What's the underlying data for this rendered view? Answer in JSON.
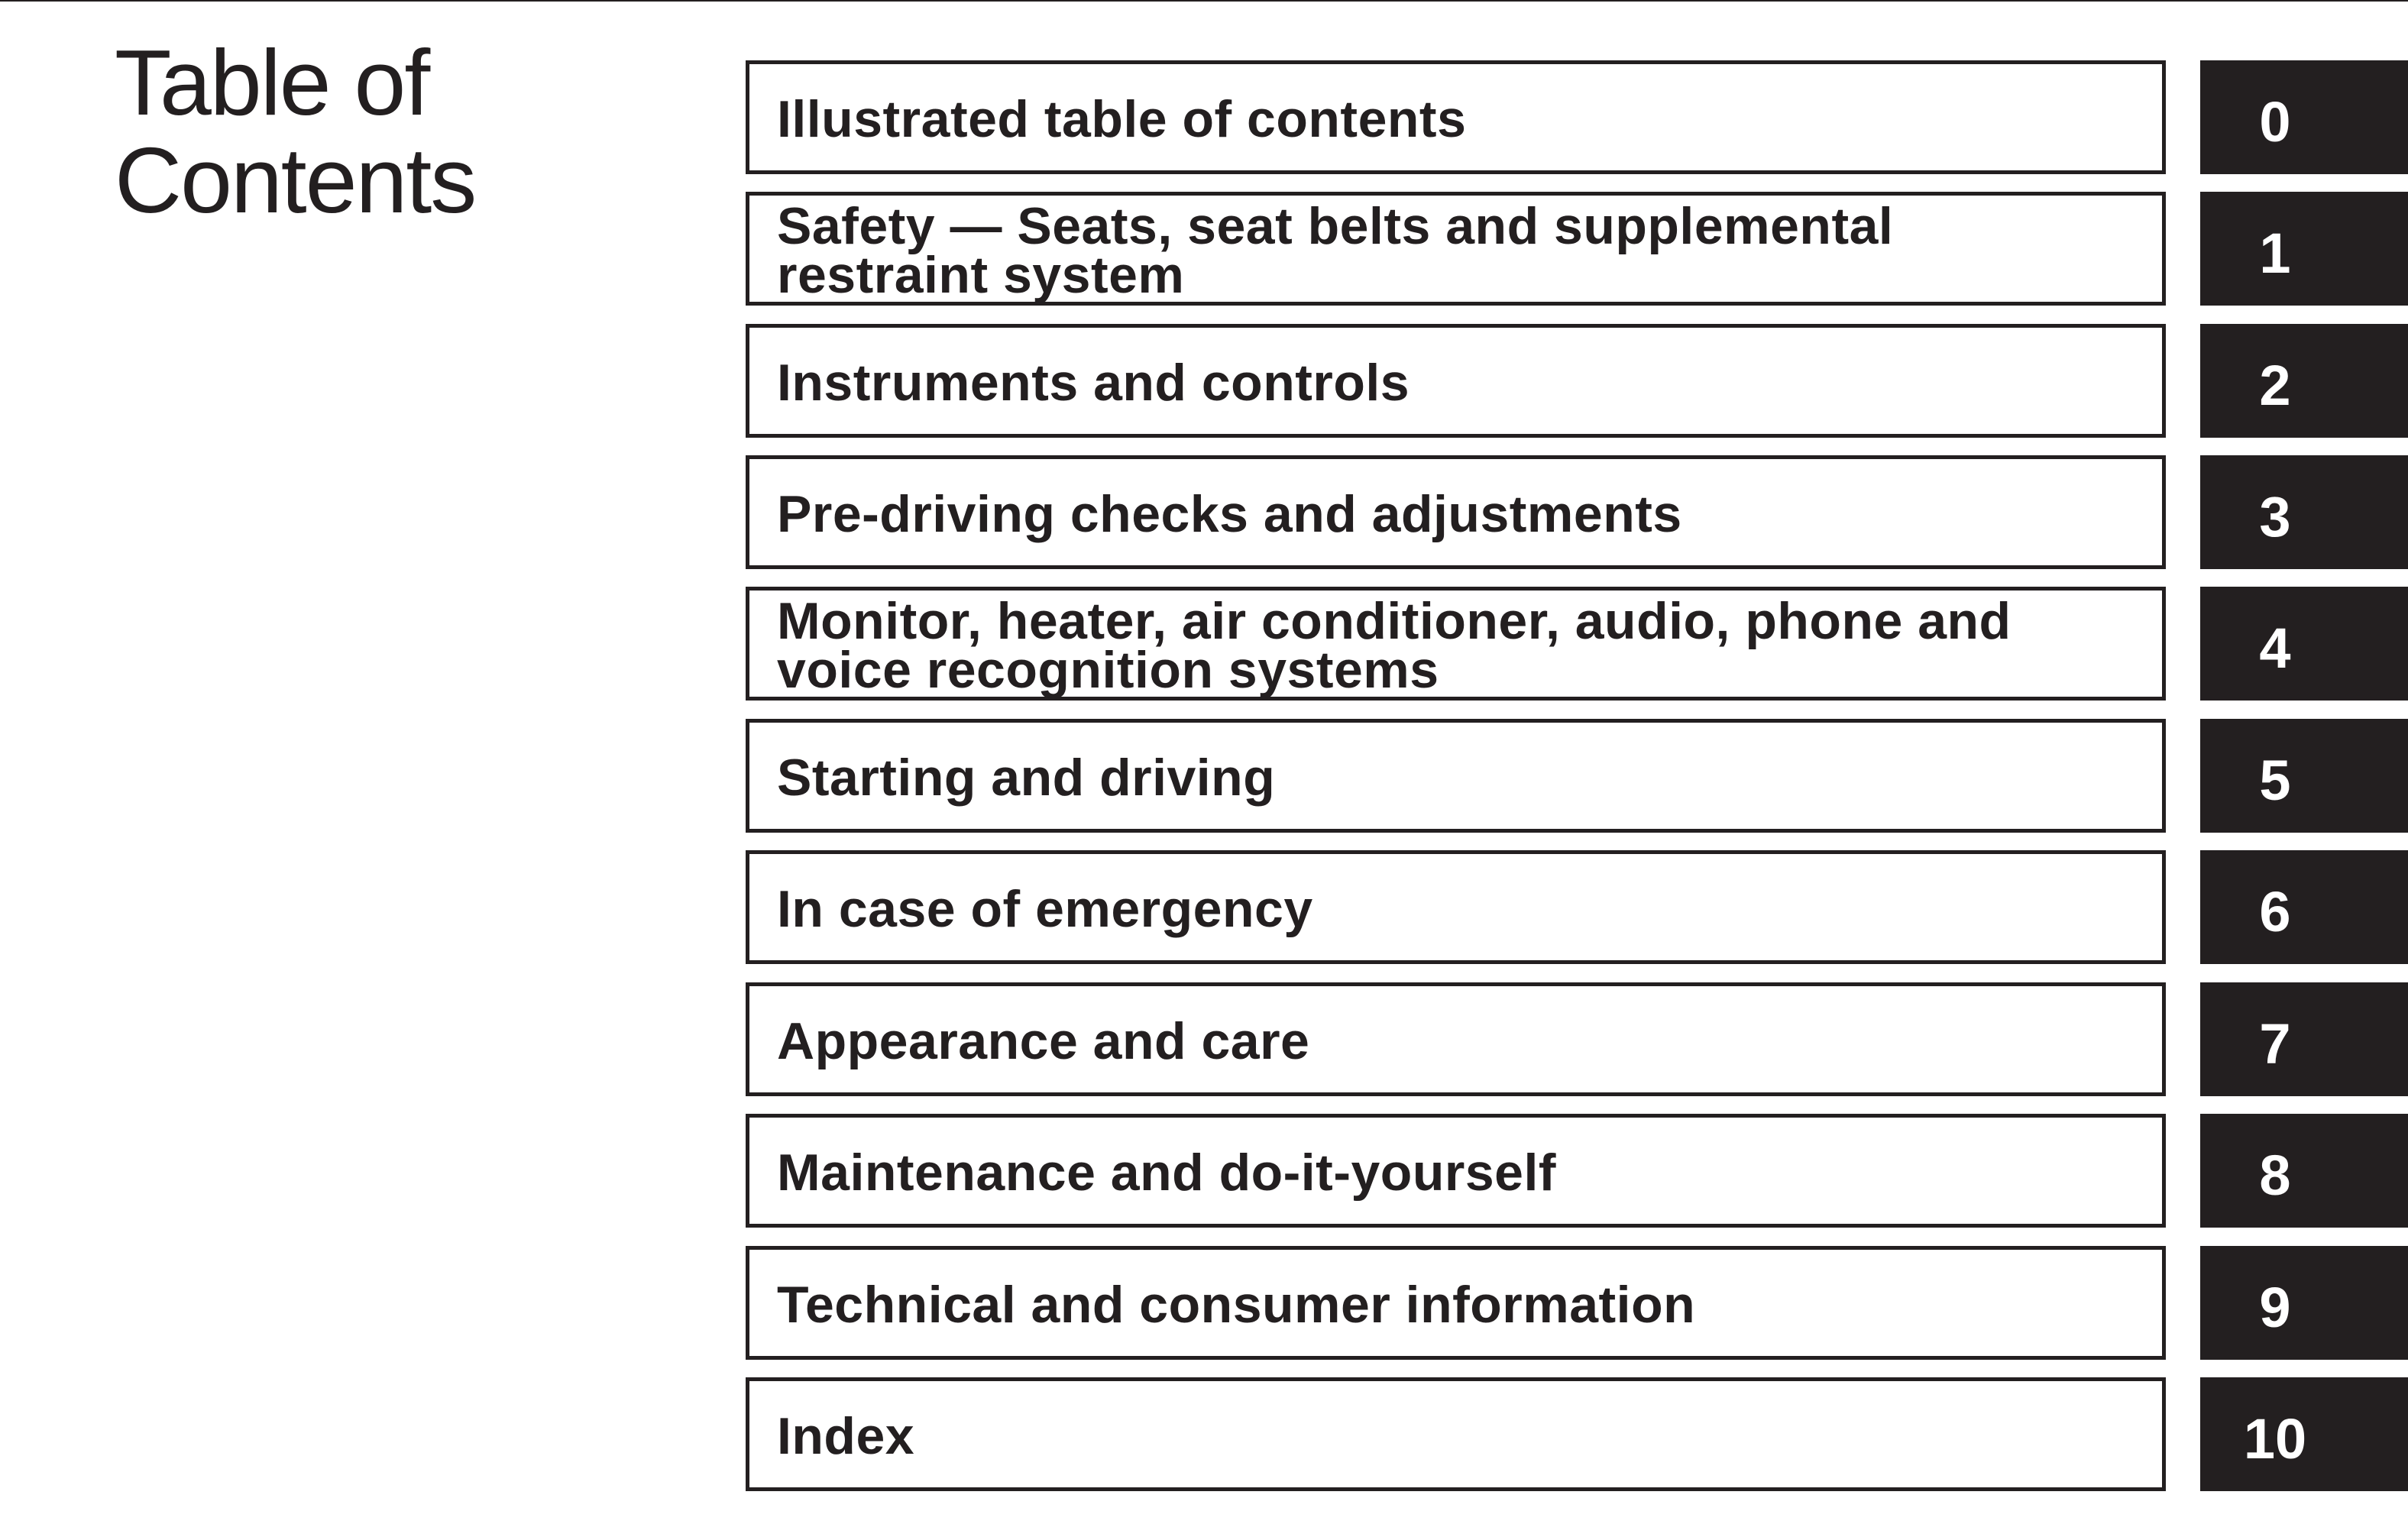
{
  "document": {
    "title_line1": "Table of",
    "title_line2": "Contents"
  },
  "colors": {
    "ink": "#231f20",
    "tab_background": "#231f20",
    "tab_text": "#ffffff",
    "page_background": "#ffffff"
  },
  "toc": [
    {
      "label": "Illustrated table of contents",
      "section": "0"
    },
    {
      "label": "Safety — Seats, seat belts and supplemental\nrestraint system",
      "section": "1"
    },
    {
      "label": "Instruments and controls",
      "section": "2"
    },
    {
      "label": "Pre-driving checks and adjustments",
      "section": "3"
    },
    {
      "label": "Monitor, heater, air conditioner, audio, phone and\nvoice recognition systems",
      "section": "4"
    },
    {
      "label": "Starting and driving",
      "section": "5"
    },
    {
      "label": "In case of emergency",
      "section": "6"
    },
    {
      "label": "Appearance and care",
      "section": "7"
    },
    {
      "label": "Maintenance and do-it-yourself",
      "section": "8"
    },
    {
      "label": "Technical and consumer information",
      "section": "9"
    },
    {
      "label": "Index",
      "section": "10"
    }
  ]
}
